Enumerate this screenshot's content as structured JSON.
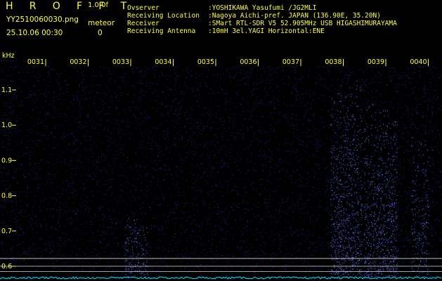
{
  "header": {
    "brand": "H R O F F T",
    "version": "1.0.0f",
    "filename": "YY2510060030.png",
    "datetime": "25.10.06 00:30",
    "meteor_label": "meteor",
    "meteor_count": "0"
  },
  "station_info": [
    {
      "label": "Ovserver",
      "value": ":YOSHIKAWA Yasufumi /JG2MLI"
    },
    {
      "label": "Receiving Location",
      "value": ":Nagoya Aichi-pref. JAPAN (136.90E, 35.20N)"
    },
    {
      "label": "Receiver",
      "value": ":SMart RTL-SDR V5 52.905MHz USB HIGASHIMURAYAMA"
    },
    {
      "label": "Receiving Antenna",
      "value": ":10mH 3el.YAGI Horizontal:ENE"
    }
  ],
  "spectrogram": {
    "y_unit": "kHz",
    "y_ticks": [
      "1.1",
      "1.0",
      "0.9",
      "0.8",
      "0.7",
      "0.6"
    ],
    "y_tick_values": [
      1.1,
      1.0,
      0.9,
      0.8,
      0.7,
      0.6
    ],
    "y_range": [
      0.575,
      1.205
    ],
    "x_ticks": [
      "0031",
      "0032",
      "0033",
      "0034",
      "0035",
      "0036",
      "0037",
      "0038",
      "0039",
      "0040"
    ],
    "x_range_minutes": [
      30.75,
      40.75
    ],
    "reference_lines_khz": [
      0.622,
      0.6,
      0.585
    ],
    "colors": {
      "text": "#ffff3c",
      "noise": "#1c20a0",
      "signal": "#6470ff",
      "baseline": "#00e8ff",
      "ref_line": "#ffffff"
    }
  }
}
